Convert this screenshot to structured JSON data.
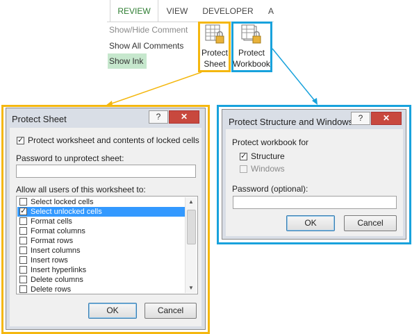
{
  "ribbon": {
    "tabs": [
      {
        "label": "REVIEW",
        "active": true
      },
      {
        "label": "VIEW",
        "active": false
      },
      {
        "label": "DEVELOPER",
        "active": false
      },
      {
        "label": "A",
        "active": false
      }
    ],
    "commands": {
      "show_hide_comment": "Show/Hide Comment",
      "show_all_comments": "Show All Comments",
      "show_ink": "Show Ink"
    },
    "protect_sheet": {
      "line1": "Protect",
      "line2": "Sheet",
      "icon": "protect-sheet-icon"
    },
    "protect_workbook": {
      "line1": "Protect",
      "line2": "Workbook",
      "icon": "protect-workbook-icon"
    },
    "accent_color": "#2e7d32",
    "highlight_colors": {
      "sheet": "#f4b70f",
      "workbook": "#18a2dc"
    }
  },
  "protect_sheet_dialog": {
    "title": "Protect Sheet",
    "help": "?",
    "close": "✕",
    "protect_contents_label": "Protect worksheet and contents of locked cells",
    "protect_contents_checked": true,
    "password_label": "Password to unprotect sheet:",
    "password_value": "",
    "allow_label": "Allow all users of this worksheet to:",
    "permissions": [
      {
        "label": "Select locked cells",
        "checked": false
      },
      {
        "label": "Select unlocked cells",
        "checked": true
      },
      {
        "label": "Format cells",
        "checked": false
      },
      {
        "label": "Format columns",
        "checked": false
      },
      {
        "label": "Format rows",
        "checked": false
      },
      {
        "label": "Insert columns",
        "checked": false
      },
      {
        "label": "Insert rows",
        "checked": false
      },
      {
        "label": "Insert hyperlinks",
        "checked": false
      },
      {
        "label": "Delete columns",
        "checked": false
      },
      {
        "label": "Delete rows",
        "checked": false
      }
    ],
    "ok": "OK",
    "cancel": "Cancel"
  },
  "protect_workbook_dialog": {
    "title": "Protect Structure and Windows",
    "help": "?",
    "close": "✕",
    "group_label": "Protect workbook for",
    "structure_label": "Structure",
    "structure_checked": true,
    "windows_label": "Windows",
    "windows_checked": false,
    "password_label": "Password (optional):",
    "password_value": "",
    "ok": "OK",
    "cancel": "Cancel"
  }
}
